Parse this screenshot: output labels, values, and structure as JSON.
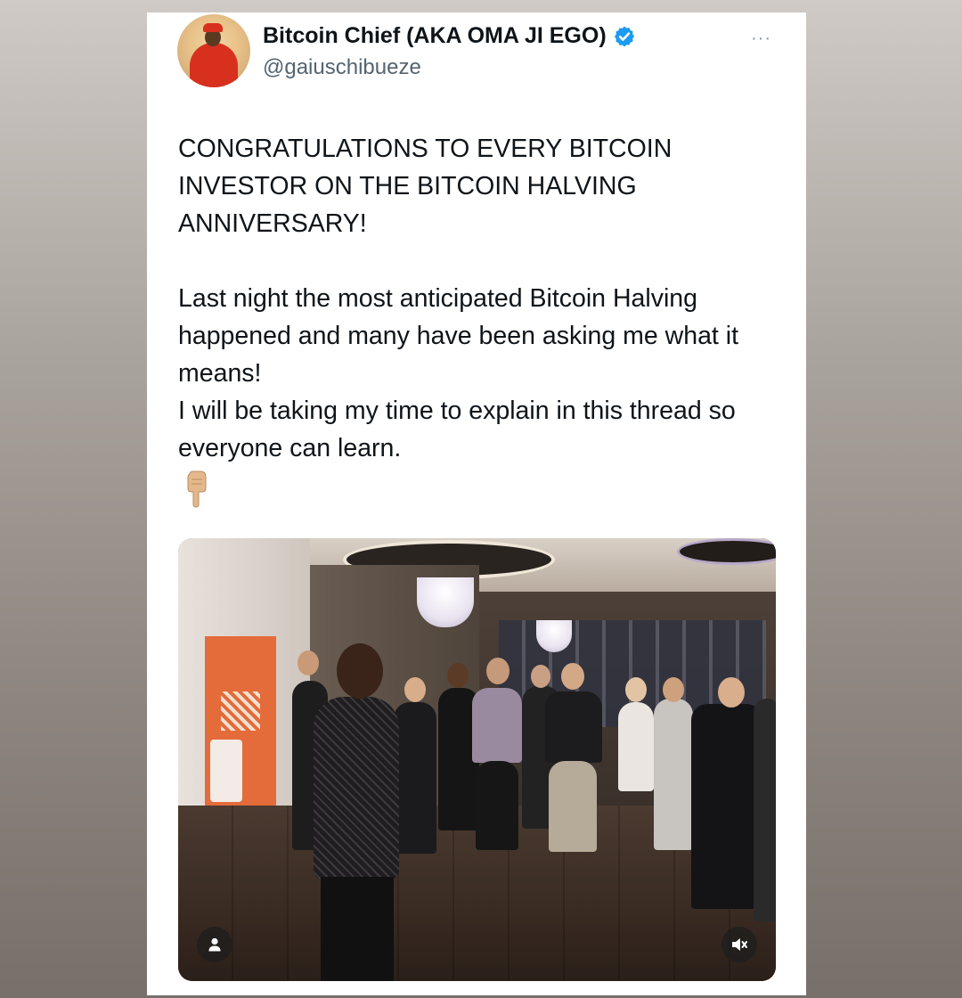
{
  "tweet": {
    "author_name": "Bitcoin Chief (AKA OMA JI EGO)",
    "handle": "@gaiuschibueze",
    "more_menu": "···",
    "paragraph1": "CONGRATULATIONS TO EVERY BITCOIN INVESTOR ON THE BITCOIN HALVING ANNIVERSARY!",
    "paragraph2_line1": "Last night the most anticipated Bitcoin Halving happened and many have been asking me what it means!",
    "paragraph2_line2": " I will be taking my time to explain in this thread so everyone can learn.",
    "emoji": "👇"
  },
  "icons": {
    "verified": "verified-badge-icon",
    "more": "more-options-icon",
    "tag_people": "person-icon",
    "mute": "speaker-muted-icon"
  },
  "colors": {
    "verified_blue": "#1d9bf0",
    "text": "#0f1419",
    "secondary_text": "#536471"
  }
}
